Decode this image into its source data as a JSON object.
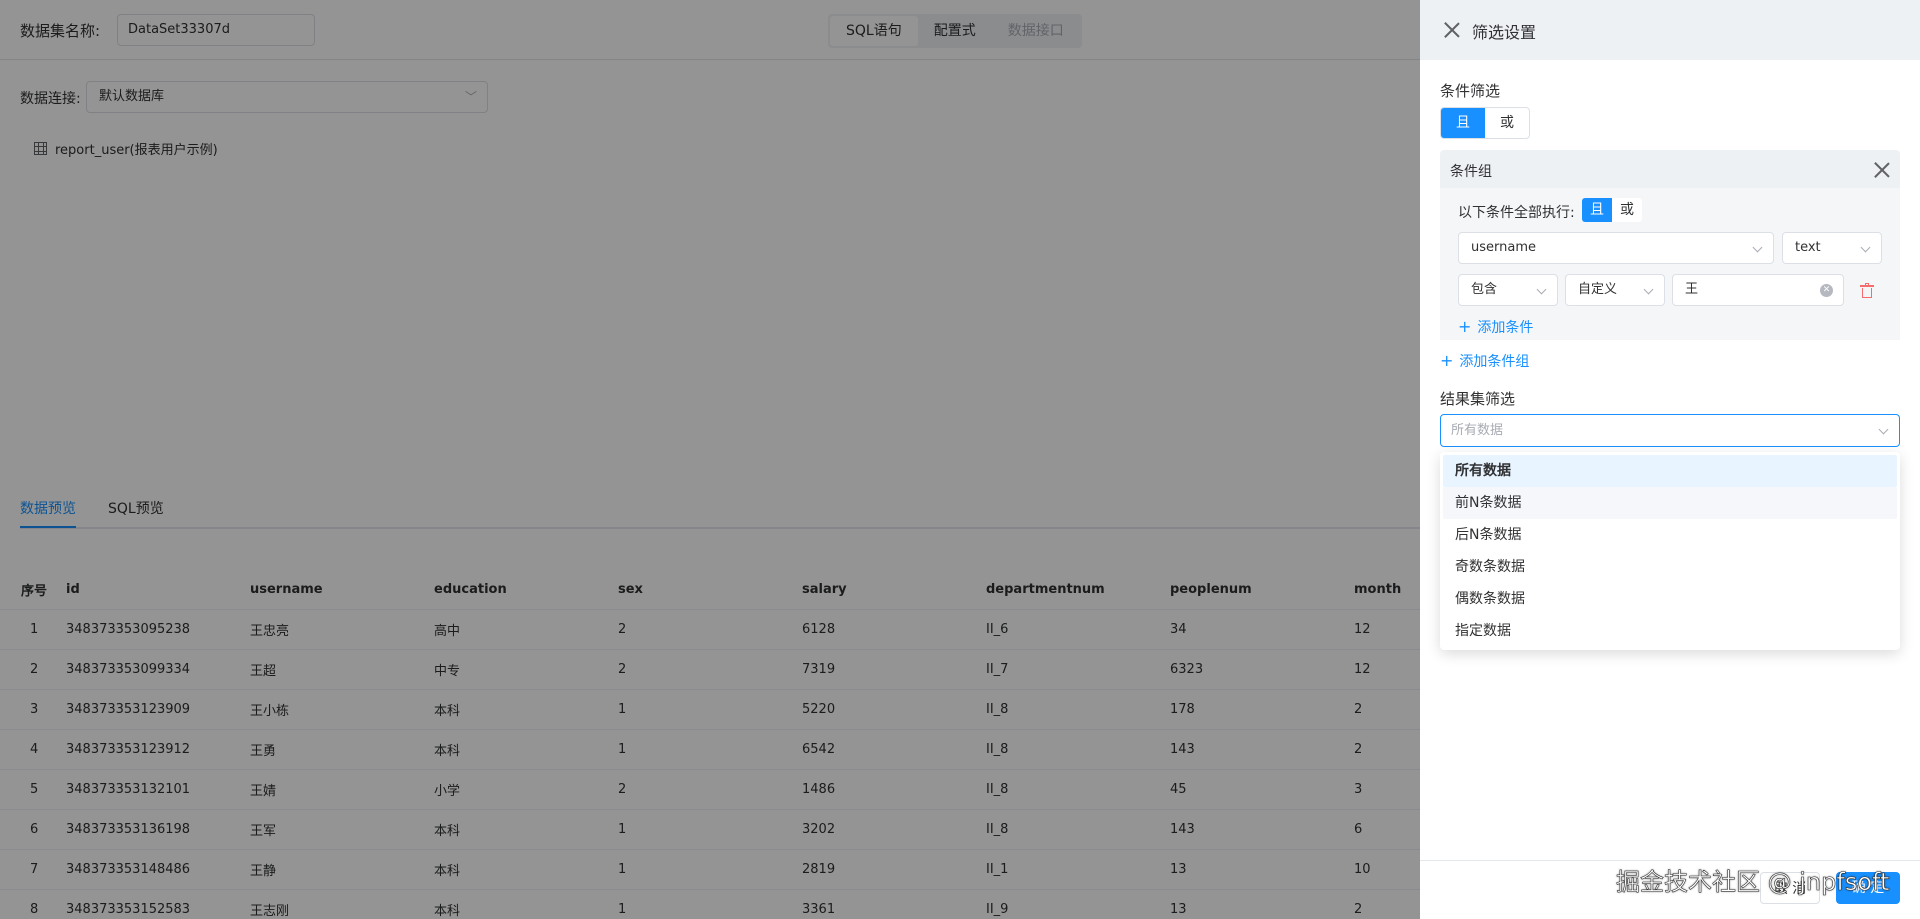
{
  "header": {
    "dataset_label": "数据集名称:",
    "dataset_name": "DataSet33307d",
    "mode_tabs": [
      "SQL语句",
      "配置式",
      "数据接口"
    ]
  },
  "connection": {
    "label": "数据连接:",
    "value": "默认数据库"
  },
  "tables": [
    {
      "name": "report_user(报表用户示例)"
    }
  ],
  "preview_tabs": [
    "数据预览",
    "SQL预览"
  ],
  "table": {
    "columns": [
      "序号",
      "id",
      "username",
      "education",
      "sex",
      "salary",
      "departmentnum",
      "peoplenum",
      "month"
    ],
    "rows": [
      [
        "1",
        "348373353095238",
        "王忠亮",
        "高中",
        "2",
        "6128",
        "II_6",
        "34",
        "12"
      ],
      [
        "2",
        "348373353099334",
        "王超",
        "中专",
        "2",
        "7319",
        "II_7",
        "6323",
        "12"
      ],
      [
        "3",
        "348373353123909",
        "王小栋",
        "本科",
        "1",
        "5220",
        "II_8",
        "178",
        "2"
      ],
      [
        "4",
        "348373353123912",
        "王勇",
        "本科",
        "1",
        "6542",
        "II_8",
        "143",
        "2"
      ],
      [
        "5",
        "348373353132101",
        "王婧",
        "小学",
        "2",
        "1486",
        "II_8",
        "45",
        "3"
      ],
      [
        "6",
        "348373353136198",
        "王军",
        "本科",
        "1",
        "3202",
        "II_8",
        "143",
        "6"
      ],
      [
        "7",
        "348373353148486",
        "王静",
        "本科",
        "1",
        "2819",
        "II_1",
        "13",
        "10"
      ],
      [
        "8",
        "348373353152583",
        "王志刚",
        "本科",
        "1",
        "3361",
        "II_9",
        "13",
        "2"
      ]
    ]
  },
  "drawer": {
    "title": "筛选设置",
    "condition_title": "条件筛选",
    "logic": {
      "and": "且",
      "or": "或",
      "selected": "且"
    },
    "group": {
      "title": "条件组",
      "exec_label": "以下条件全部执行:",
      "field": "username",
      "field_type": "text",
      "operator": "包含",
      "value_mode": "自定义",
      "value": "王",
      "add_condition": "添加条件"
    },
    "add_group": "添加条件组",
    "result_title": "结果集筛选",
    "result_placeholder": "所有数据",
    "result_options": [
      "所有数据",
      "前N条数据",
      "后N条数据",
      "奇数条数据",
      "偶数条数据",
      "指定数据"
    ],
    "result_selected": "所有数据",
    "cancel": "取 消",
    "confirm": "确 定"
  },
  "watermark": "掘金技术社区 @ jnpfsoft"
}
